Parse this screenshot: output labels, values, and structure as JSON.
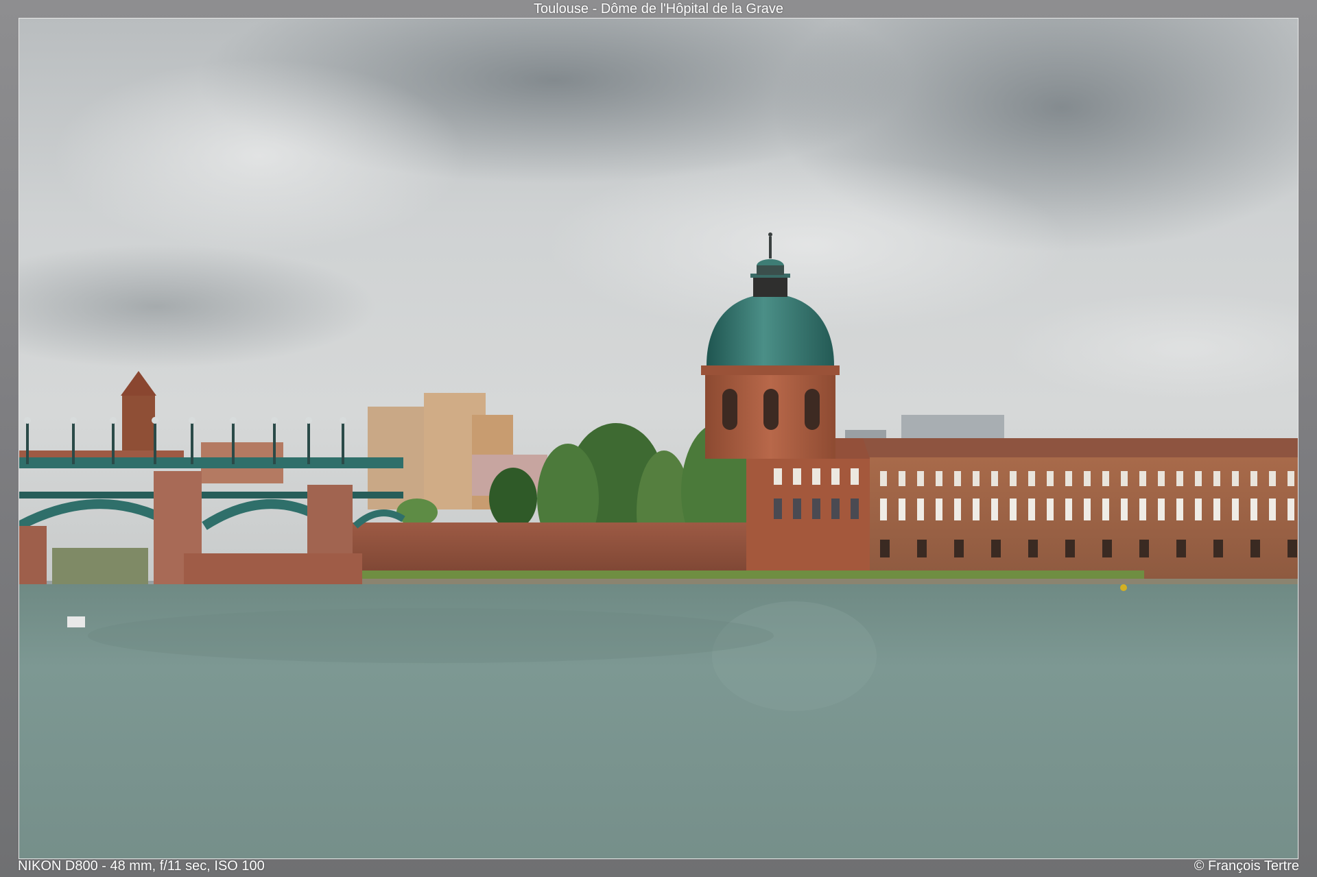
{
  "header": {
    "title": "Toulouse - Dôme de l'Hôpital de la Grave"
  },
  "footer": {
    "exif": "NIKON D800 - 48 mm, f/11 sec, ISO 100",
    "credit": "© François Tertre"
  },
  "photo": {
    "subject": "dome-of-hopital-de-la-grave",
    "colors": {
      "sky": "#c9cccd",
      "cloud_dark": "#7d8488",
      "river": "#7d9590",
      "dome": "#3f7f78",
      "brick": "#a85a3c",
      "bridge": "#2f6f6a"
    }
  }
}
